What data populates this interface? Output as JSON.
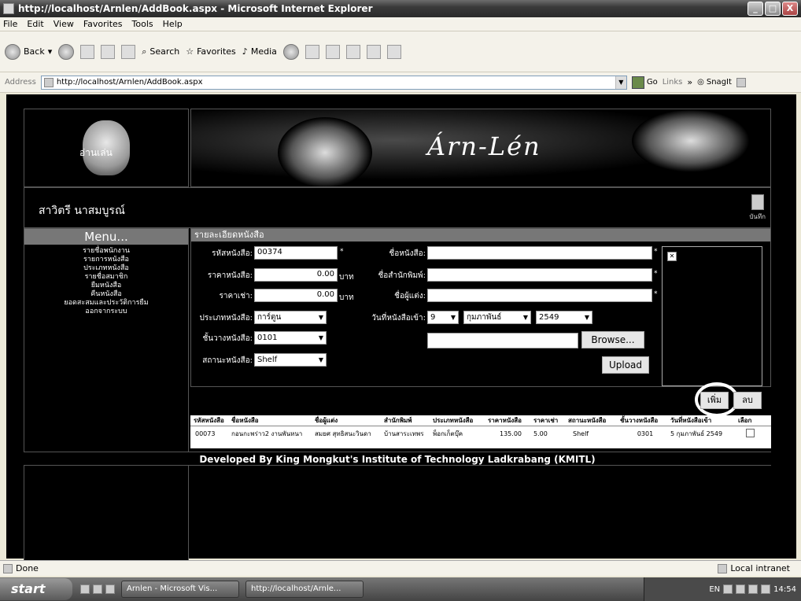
{
  "window": {
    "title": "http://localhost/Arnlen/AddBook.aspx - Microsoft Internet Explorer",
    "controls": [
      "_",
      "□",
      "X"
    ]
  },
  "menubar": [
    "File",
    "Edit",
    "View",
    "Favorites",
    "Tools",
    "Help"
  ],
  "toolbar": {
    "back": "Back",
    "search": "Search",
    "favorites": "Favorites",
    "media": "Media"
  },
  "address": {
    "label": "Address",
    "url": "http://localhost/Arnlen/AddBook.aspx",
    "go": "Go",
    "links": "Links",
    "snagit": "SnagIt"
  },
  "site": {
    "logo_text": "อ่านเล่น",
    "banner_title": "Árn-Lén",
    "username": "สาวิตรี นาสมบูรณ์",
    "save_label": "บันทึก",
    "menu_title": "Menu...",
    "menu_items": [
      "รายชื่อพนักงาน",
      "รายการหนังสือ",
      "ประเภทหนังสือ",
      "รายชื่อสมาชิก",
      "ยืมหนังสือ",
      "คืนหนังสือ",
      "ยอดสะสมและประวัติการยืม",
      "ออกจากระบบ"
    ],
    "footer": "Developed By King Mongkut's Institute of Technology Ladkrabang (KMITL)"
  },
  "form": {
    "heading": "รายละเอียดหนังสือ",
    "book_id_label": "รหัสหนังสือ:",
    "book_id_value": "00374",
    "price_label": "ราคาหนังสือ:",
    "price_value": "0.00",
    "rent_label": "ราคาเช่า:",
    "rent_value": "0.00",
    "unit": "บาท",
    "type_label": "ประเภทหนังสือ:",
    "type_value": "การ์ตูน",
    "shelf_label": "ชั้นวางหนังสือ:",
    "shelf_value": "0101",
    "status_label": "สถานะหนังสือ:",
    "status_value": "Shelf",
    "name_label": "ชื่อหนังสือ:",
    "publisher_label": "ชื่อสำนักพิมพ์:",
    "author_label": "ชื่อผู้แต่ง:",
    "date_label": "วันที่หนังสือเข้า:",
    "day_value": "9",
    "month_value": "กุมภาพันธ์",
    "year_value": "2549",
    "browse": "Browse...",
    "upload": "Upload",
    "required": "*"
  },
  "actions": {
    "add": "เพิ่ม",
    "delete": "ลบ"
  },
  "table": {
    "headers": [
      "รหัสหนังสือ",
      "ชื่อหนังสือ",
      "ชื่อผู้แต่ง",
      "สำนักพิมพ์",
      "ประเภทหนังสือ",
      "ราคาหนังสือ",
      "ราคาเช่า",
      "สถานะหนังสือ",
      "ชั้นวางหนังสือ",
      "วันที่หนังสือเข้า",
      "เลือก"
    ],
    "rows": [
      [
        "00073",
        "กอนกะพร่าว2 งานพันหนา",
        "สมยศ สุทธิสนะวินดา",
        "บ้านสาระเทพร",
        "พ็อกเก็ตบุ๊ค",
        "135.00",
        "5.00",
        "Shelf",
        "0301",
        "5 กุมภาพันธ์ 2549"
      ]
    ]
  },
  "status": {
    "left": "Done",
    "right": "Local intranet"
  },
  "taskbar": {
    "start": "start",
    "tasks": [
      "Arnlen - Microsoft Vis...",
      "http://localhost/Arnle..."
    ],
    "clock": "14:54",
    "lang": "EN"
  }
}
